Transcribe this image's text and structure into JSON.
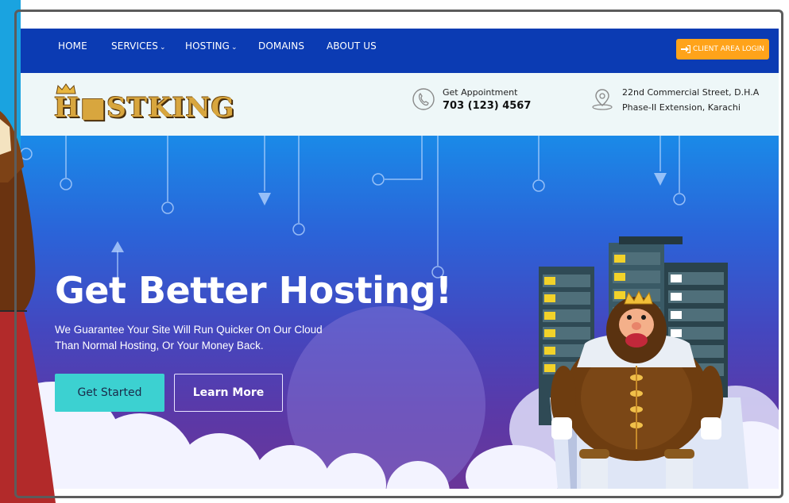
{
  "nav": {
    "items": [
      {
        "label": "HOME",
        "has_dropdown": false
      },
      {
        "label": "SERVICES",
        "has_dropdown": true
      },
      {
        "label": "HOSTING",
        "has_dropdown": true
      },
      {
        "label": "DOMAINS",
        "has_dropdown": false
      },
      {
        "label": "ABOUT US",
        "has_dropdown": false
      }
    ],
    "login_label": "CLIENT AREA LOGIN",
    "login_icon": "login-icon",
    "colors": {
      "bar": "#0b3bb3",
      "login": "#ffa31a"
    }
  },
  "header": {
    "logo_text": "H■STKING",
    "appointment": {
      "icon": "phone-icon",
      "label": "Get Appointment",
      "value": "703 (123) 4567"
    },
    "address": {
      "icon": "location-pin-icon",
      "line1": "22nd Commercial Street, D.H.A",
      "line2": "Phase-II Extension, Karachi"
    }
  },
  "hero": {
    "title": "Get Better Hosting!",
    "subtitle_line1": "We Guarantee Your Site Will Run Quicker On Our Cloud",
    "subtitle_line2": "Than Normal Hosting, Or Your Money Back.",
    "primary_button": "Get Started",
    "secondary_button": "Learn More",
    "colors": {
      "primary_button": "#3cd1d1",
      "gradient_top": "#1a8ae8",
      "gradient_bottom": "#6a3699"
    }
  }
}
